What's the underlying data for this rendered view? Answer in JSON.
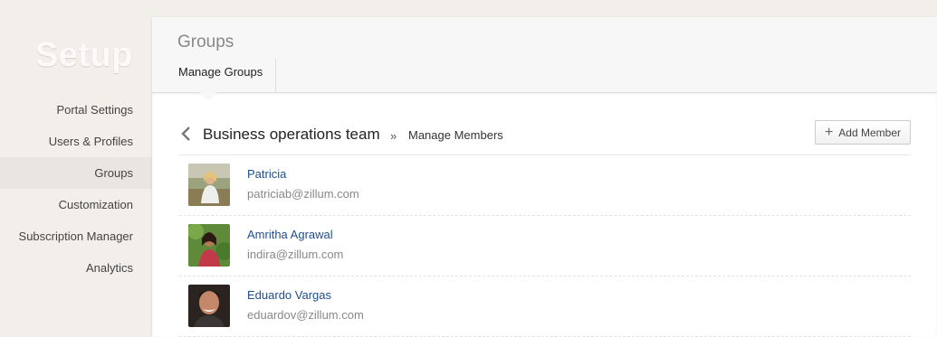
{
  "sidebar": {
    "title": "Setup",
    "items": [
      {
        "label": "Portal Settings"
      },
      {
        "label": "Users & Profiles"
      },
      {
        "label": "Groups"
      },
      {
        "label": "Customization"
      },
      {
        "label": "Subscription Manager"
      },
      {
        "label": "Analytics"
      }
    ],
    "active_index": 2
  },
  "header": {
    "title": "Groups",
    "tabs": [
      {
        "label": "Manage Groups"
      }
    ]
  },
  "breadcrumb": {
    "team": "Business operations team",
    "separator": "»",
    "current": "Manage Members"
  },
  "toolbar": {
    "add_member_label": "Add Member"
  },
  "members": [
    {
      "name": "Patricia",
      "email": "patriciab@zillum.com"
    },
    {
      "name": "Amritha Agrawal",
      "email": "indira@zillum.com"
    },
    {
      "name": "Eduardo Vargas",
      "email": "eduardov@zillum.com"
    }
  ],
  "colors": {
    "sidebar_bg": "#f2eeea",
    "link": "#1f4e8c",
    "muted": "#888888"
  }
}
